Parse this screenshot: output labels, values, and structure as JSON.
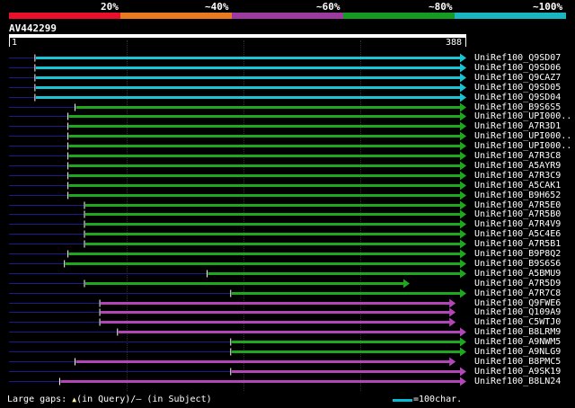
{
  "coverage_legend": {
    "labels": [
      "20%",
      "~40%",
      "~60%",
      "~80%",
      "~100%"
    ],
    "colors": [
      "#e8102a",
      "#e97a1e",
      "#9c3aa0",
      "#159a22",
      "#19b6c2"
    ]
  },
  "query": {
    "id": "AV442299",
    "start_label": "1",
    "end_label": "388",
    "length": 388
  },
  "colors": {
    "cyan": "#19c4d4",
    "green": "#1da81d",
    "magenta": "#b445b8",
    "thin": "#1a1a8c"
  },
  "hits": [
    {
      "name": "UniRef100_Q9SD07",
      "class": "cyan",
      "start": 23,
      "end": 388
    },
    {
      "name": "UniRef100_Q9SD06",
      "class": "cyan",
      "start": 23,
      "end": 388
    },
    {
      "name": "UniRef100_Q9CAZ7",
      "class": "cyan",
      "start": 23,
      "end": 388
    },
    {
      "name": "UniRef100_Q9SD05",
      "class": "cyan",
      "start": 23,
      "end": 388
    },
    {
      "name": "UniRef100_Q9SD04",
      "class": "cyan",
      "start": 23,
      "end": 388
    },
    {
      "name": "UniRef100_B9S6S5",
      "class": "green",
      "start": 57,
      "end": 388
    },
    {
      "name": "UniRef100_UPI000..",
      "class": "green",
      "start": 51,
      "end": 388
    },
    {
      "name": "UniRef100_A7R3D1",
      "class": "green",
      "start": 51,
      "end": 388
    },
    {
      "name": "UniRef100_UPI000..",
      "class": "green",
      "start": 51,
      "end": 388
    },
    {
      "name": "UniRef100_UPI000..",
      "class": "green",
      "start": 51,
      "end": 388
    },
    {
      "name": "UniRef100_A7R3C8",
      "class": "green",
      "start": 51,
      "end": 388
    },
    {
      "name": "UniRef100_A5AYR9",
      "class": "green",
      "start": 51,
      "end": 388
    },
    {
      "name": "UniRef100_A7R3C9",
      "class": "green",
      "start": 51,
      "end": 388
    },
    {
      "name": "UniRef100_A5CAK1",
      "class": "green",
      "start": 51,
      "end": 388
    },
    {
      "name": "UniRef100_B9H652",
      "class": "green",
      "start": 51,
      "end": 388
    },
    {
      "name": "UniRef100_A7R5E0",
      "class": "green",
      "start": 65,
      "end": 388
    },
    {
      "name": "UniRef100_A7R5B0",
      "class": "green",
      "start": 65,
      "end": 388
    },
    {
      "name": "UniRef100_A7R4V9",
      "class": "green",
      "start": 65,
      "end": 388
    },
    {
      "name": "UniRef100_A5C4E6",
      "class": "green",
      "start": 65,
      "end": 388
    },
    {
      "name": "UniRef100_A7R5B1",
      "class": "green",
      "start": 65,
      "end": 388
    },
    {
      "name": "UniRef100_B9P8Q2",
      "class": "green",
      "start": 51,
      "end": 388
    },
    {
      "name": "UniRef100_B9S6S6",
      "class": "green",
      "start": 48,
      "end": 388
    },
    {
      "name": "UniRef100_A5BMU9",
      "class": "green",
      "start": 169,
      "end": 388
    },
    {
      "name": "UniRef100_A7R5D9",
      "class": "green",
      "start": 65,
      "end": 340
    },
    {
      "name": "UniRef100_A7R7C8",
      "class": "green",
      "start": 189,
      "end": 388
    },
    {
      "name": "UniRef100_Q9FWE6",
      "class": "magenta",
      "start": 78,
      "end": 379
    },
    {
      "name": "UniRef100_Q109A9",
      "class": "magenta",
      "start": 78,
      "end": 379
    },
    {
      "name": "UniRef100_C5WTJ0",
      "class": "magenta",
      "start": 78,
      "end": 379
    },
    {
      "name": "UniRef100_B8LRM9",
      "class": "magenta",
      "start": 93,
      "end": 388
    },
    {
      "name": "UniRef100_A9NWM5",
      "class": "green",
      "start": 189,
      "end": 388
    },
    {
      "name": "UniRef100_A9NLG9",
      "class": "green",
      "start": 189,
      "end": 388
    },
    {
      "name": "UniRef100_B8PMC5",
      "class": "magenta",
      "start": 57,
      "end": 379
    },
    {
      "name": "UniRef100_A9SK19",
      "class": "magenta",
      "start": 189,
      "end": 388
    },
    {
      "name": "UniRef100_B8LN24",
      "class": "magenta",
      "start": 44,
      "end": 388
    }
  ],
  "footer": {
    "large_gaps_prefix": "Large gaps: ",
    "query_symbol": "▲",
    "in_query": "(in Query)/",
    "subject_symbol": "–",
    "in_subject": " (in Subject)",
    "scale_text": "=100char."
  }
}
